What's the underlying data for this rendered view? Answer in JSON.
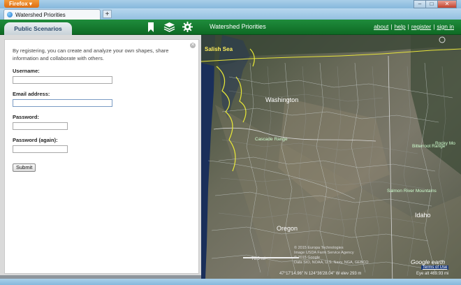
{
  "browser": {
    "app_button": "Firefox",
    "tab_title": "Watershed Priorities",
    "new_tab": "+",
    "window_buttons": [
      "–",
      "□",
      "✕"
    ]
  },
  "header": {
    "public_tab": "Public Scenarios",
    "icons": [
      "bookmark-icon",
      "layers-icon",
      "gear-icon"
    ],
    "title": "Watershed Priorities",
    "links": {
      "about": "about",
      "help": "help",
      "register": "register",
      "signin": "sign in"
    },
    "separator": "|",
    "colors": {
      "header_green": "#13782c",
      "tab_text": "#2c4a6a"
    }
  },
  "form": {
    "intro": "By registering, you can create and analyze your own shapes, share information and collaborate with others.",
    "username_label": "Username:",
    "username_value": "",
    "email_label": "Email address:",
    "email_value": "",
    "password_label": "Password:",
    "password_value": "",
    "password2_label": "Password (again):",
    "password2_value": "",
    "submit": "Submit"
  },
  "map": {
    "labels": {
      "salish": "Salish Sea",
      "washington": "Washington",
      "cascade": "Cascade Range",
      "rocky": "Rocky Mo",
      "bitterroot": "Bitterroot Range",
      "salmon": "Salmon River Mountains",
      "idaho": "Idaho",
      "oregon": "Oregon"
    },
    "scale": "76.5 mi",
    "attribution": {
      "line1": "© 2015 Europa Technologies",
      "line2": "Image USDA Farm Service Agency",
      "line3": "© 2015 Google",
      "line4": "Data SIO, NOAA, U.S. Navy, NGA, GEBCO"
    },
    "google_logo": "Google earth",
    "terms": "Terms of Use",
    "coords": "47°17'14.96\" N 124°36'28.04\" W elev  293 m",
    "eye_alt": "Eye alt  469.93 mi"
  }
}
